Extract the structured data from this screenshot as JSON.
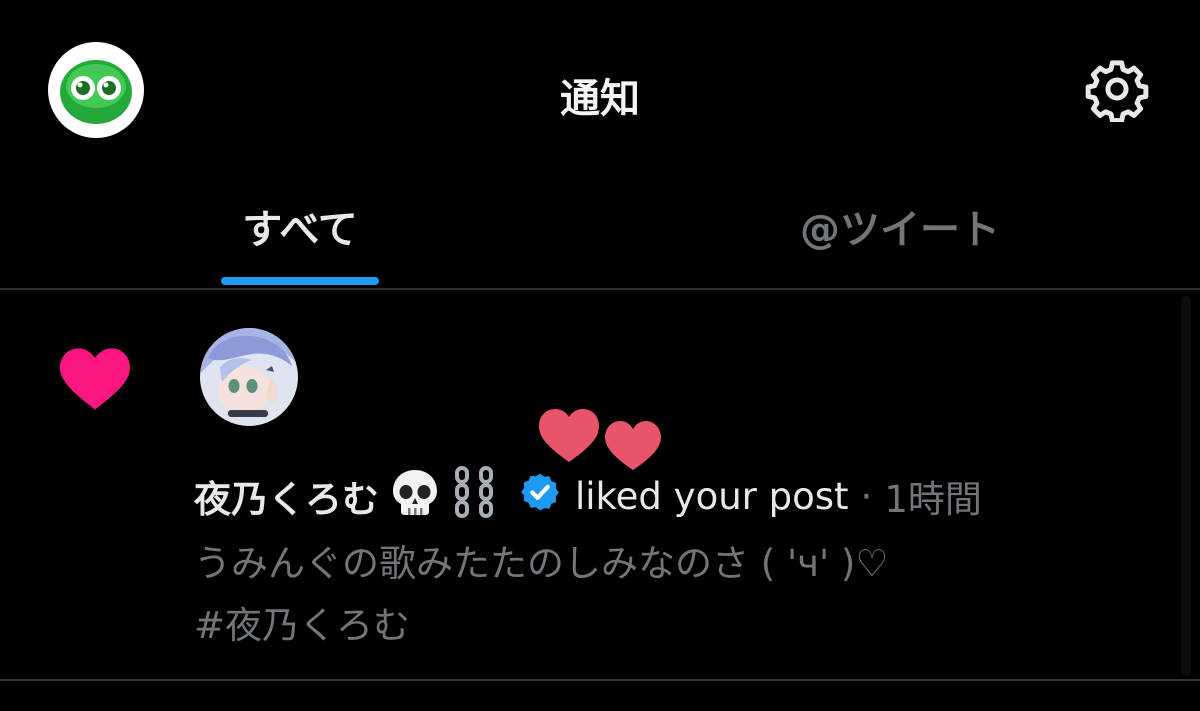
{
  "header": {
    "title": "通知",
    "profile_icon": "puyo-avatar-icon",
    "settings_icon": "gear-icon"
  },
  "tabs": [
    {
      "label": "すべて",
      "active": true
    },
    {
      "label": "@ツイート",
      "active": false
    }
  ],
  "notification": {
    "type_icon": "heart-icon",
    "user_name": "夜乃くろむ",
    "name_emojis": [
      "skull-emoji",
      "chains-emoji"
    ],
    "verified": true,
    "action": "liked your post",
    "separator": "·",
    "time": "1時間",
    "tweet_line1": "うみんぐの歌みたたのしみなのさ ( 'ч' )♡",
    "tweet_line2": "#夜乃くろむ"
  },
  "colors": {
    "background": "#000000",
    "accent": "#1d9bf0",
    "like": "#f91880",
    "text_primary": "#e7e9ea",
    "text_secondary": "#71767b"
  }
}
